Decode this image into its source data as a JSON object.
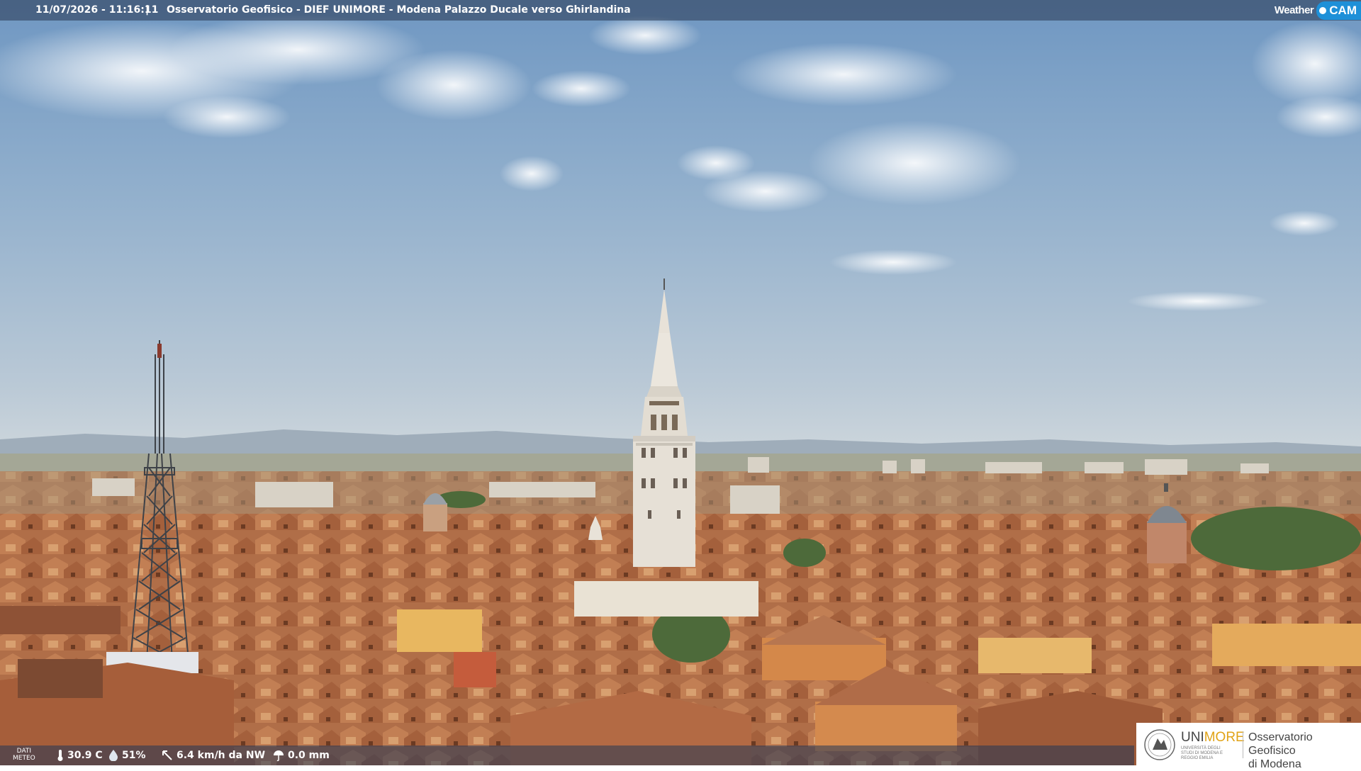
{
  "header": {
    "timestamp": "11/07/2026 - 11:16:11",
    "separator": "|",
    "caption": "Osservatorio Geofisico - DIEF UNIMORE - Modena Palazzo Ducale verso Ghirlandina",
    "brand_left": "Weather",
    "brand_right": "CAM"
  },
  "weather": {
    "label_line1": "DATI",
    "label_line2": "METEO",
    "temperature": "30.9 C",
    "humidity": "51%",
    "wind": "6.4 km/h da NW",
    "rain": "0.0 mm"
  },
  "logo": {
    "uni_prefix": "UNI",
    "uni_suffix": "MORE",
    "uni_subtext": "UNIVERSITÀ DEGLI STUDI DI MODENA E REGGIO EMILIA",
    "observatory_line1": "Osservatorio Geofisico",
    "observatory_line2": "di Modena"
  },
  "colors": {
    "sky_top": "#7fa4c8",
    "sky_horizon": "#c9d4dc",
    "roofs": "#b5704a",
    "tower": "#e8e2d8",
    "accent_blue": "#1e90d8",
    "unimore_gold": "#e1a317"
  }
}
